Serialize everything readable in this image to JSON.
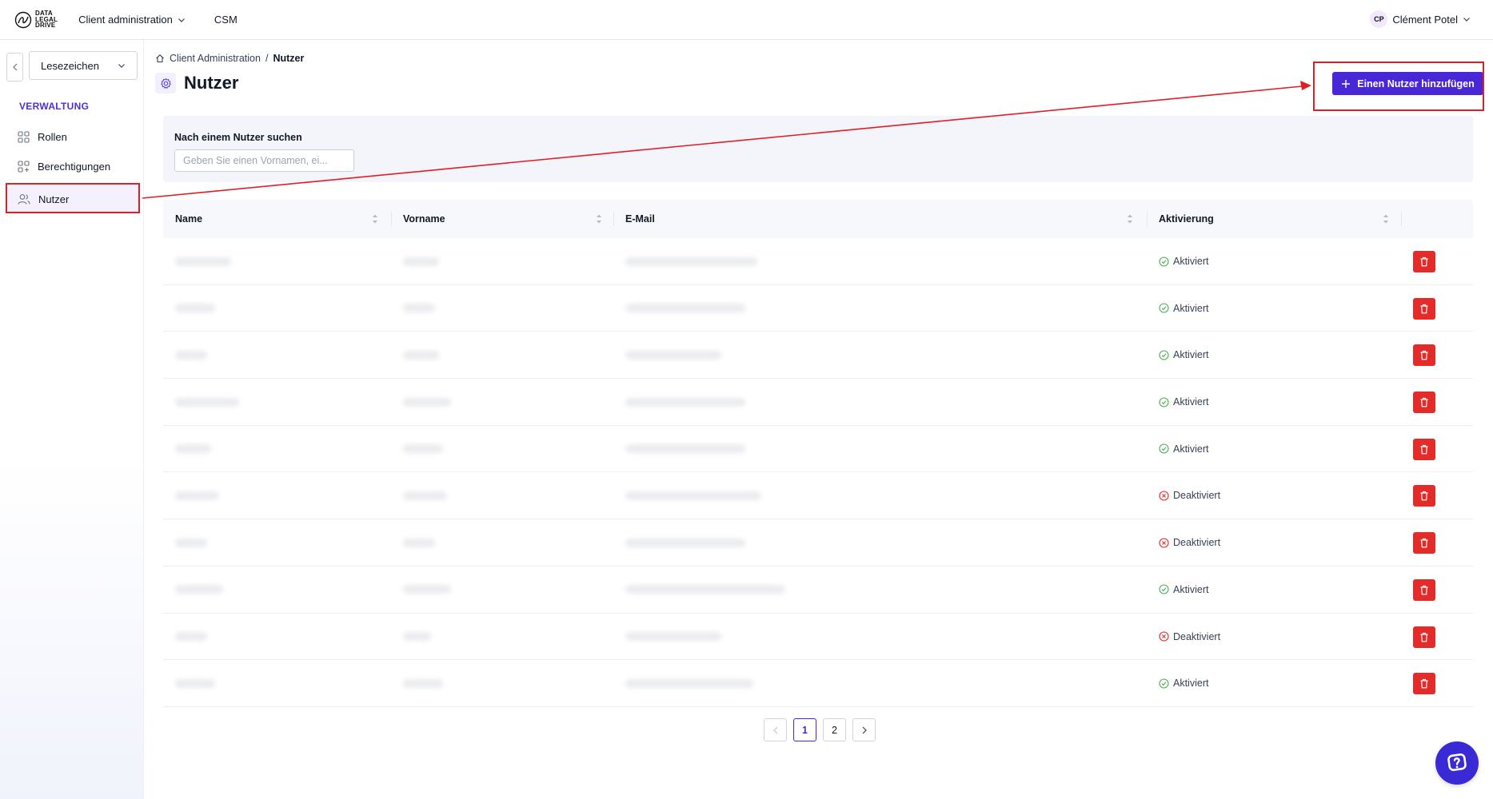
{
  "topbar": {
    "logo_lines": [
      "DATA",
      "LEGAL",
      "DRIVE"
    ],
    "nav": [
      {
        "label": "Client administration",
        "has_dropdown": true
      },
      {
        "label": "CSM",
        "has_dropdown": false
      }
    ],
    "user": {
      "initials": "CP",
      "name": "Clément Potel"
    }
  },
  "sidebar": {
    "bookmark_select": {
      "value": "Lesezeichen"
    },
    "section_title": "VERWALTUNG",
    "items": [
      {
        "label": "Rollen",
        "icon": "grid-icon",
        "active": false
      },
      {
        "label": "Berechtigungen",
        "icon": "grid-plus-icon",
        "active": false
      },
      {
        "label": "Nutzer",
        "icon": "users-icon",
        "active": true
      }
    ]
  },
  "breadcrumb": {
    "home_label": "Client Administration",
    "separator": "/",
    "current": "Nutzer"
  },
  "page": {
    "title": "Nutzer",
    "title_icon": "gear-icon",
    "add_button_label": "Einen Nutzer hinzufügen"
  },
  "search": {
    "label": "Nach einem Nutzer suchen",
    "placeholder": "Geben Sie einen Vornamen, ei...",
    "value": ""
  },
  "table": {
    "columns": [
      "Name",
      "Vorname",
      "E-Mail",
      "Aktivierung"
    ],
    "rows": [
      {
        "status": "Aktiviert",
        "active": true
      },
      {
        "status": "Aktiviert",
        "active": true
      },
      {
        "status": "Aktiviert",
        "active": true
      },
      {
        "status": "Aktiviert",
        "active": true
      },
      {
        "status": "Aktiviert",
        "active": true
      },
      {
        "status": "Deaktiviert",
        "active": false
      },
      {
        "status": "Deaktiviert",
        "active": false
      },
      {
        "status": "Aktiviert",
        "active": true
      },
      {
        "status": "Deaktiviert",
        "active": false
      },
      {
        "status": "Aktiviert",
        "active": true
      }
    ]
  },
  "pagination": {
    "pages": [
      "1",
      "2"
    ],
    "current": "1"
  },
  "colors": {
    "accent": "#4727d6",
    "danger": "#e52a2a",
    "success": "#4caf50",
    "annotation": "#e11d28"
  }
}
